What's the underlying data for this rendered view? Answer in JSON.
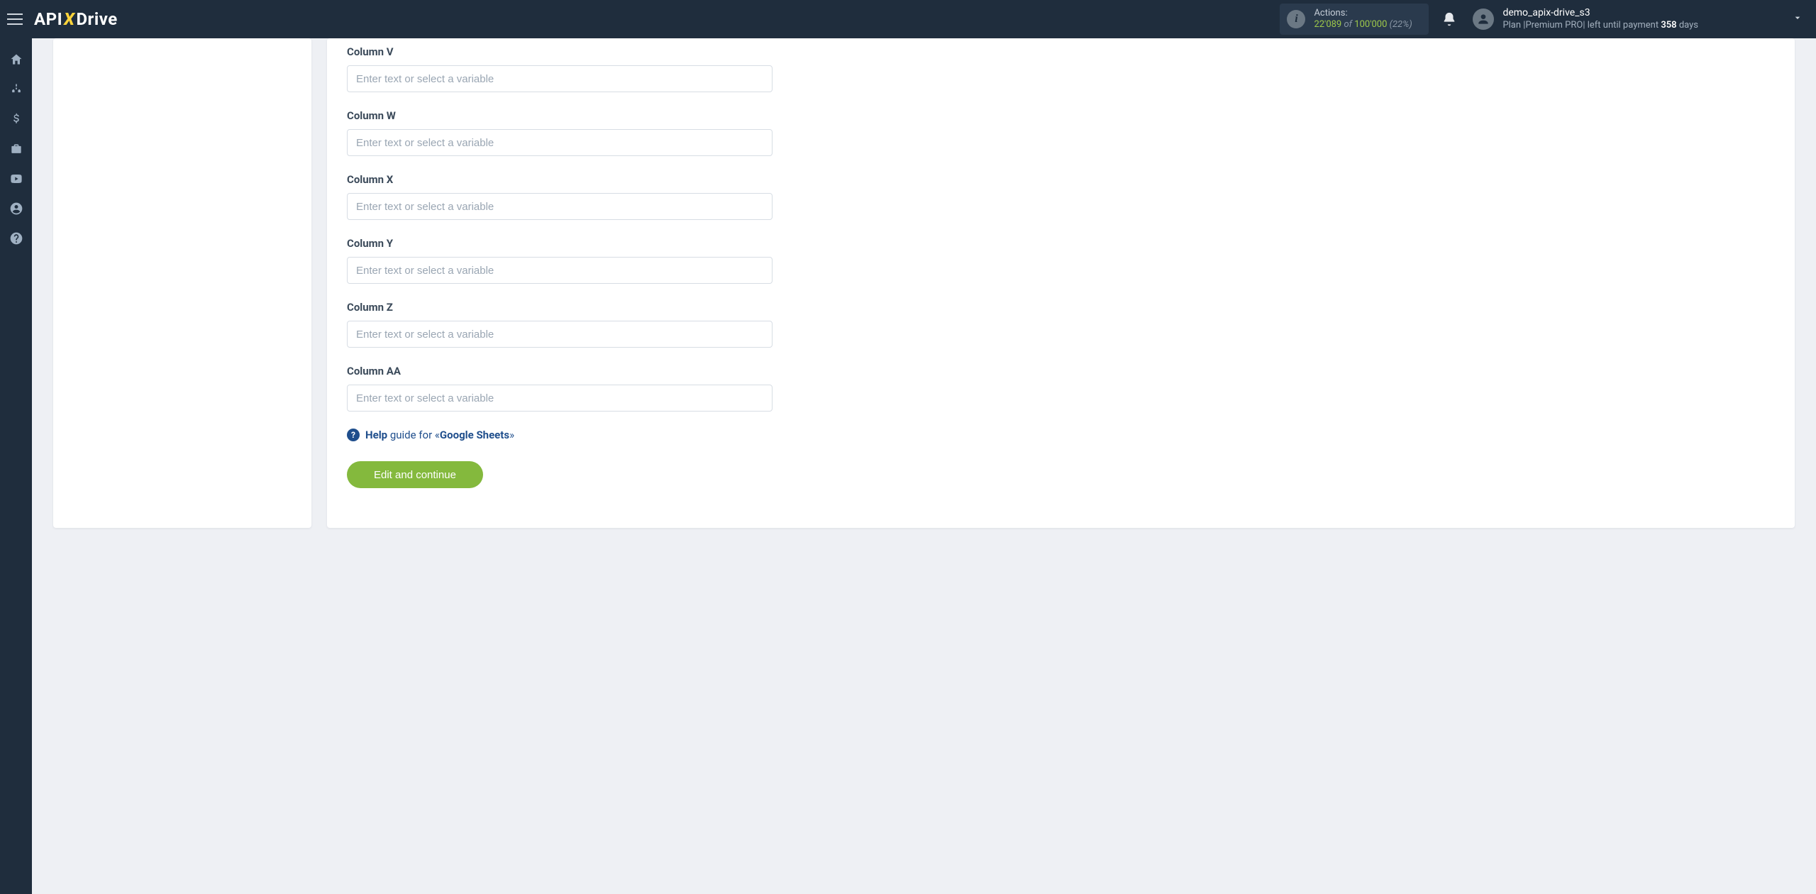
{
  "header": {
    "logo_api": "API",
    "logo_x": "X",
    "logo_drive": "Drive",
    "actions": {
      "label": "Actions:",
      "used": "22'089",
      "of": "of",
      "total": "100'000",
      "percent": "(22%)"
    },
    "user": {
      "name": "demo_apix-drive_s3",
      "plan_prefix": "Plan |Premium PRO| left until payment ",
      "plan_days": "358",
      "plan_suffix": " days"
    }
  },
  "form": {
    "placeholder": "Enter text or select a variable",
    "fields": [
      {
        "label": "Column V"
      },
      {
        "label": "Column W"
      },
      {
        "label": "Column X"
      },
      {
        "label": "Column Y"
      },
      {
        "label": "Column Z"
      },
      {
        "label": "Column AA"
      }
    ],
    "help": {
      "help_word": "Help",
      "mid": " guide for «",
      "target": "Google Sheets",
      "end": "»"
    },
    "continue_label": "Edit and continue"
  }
}
